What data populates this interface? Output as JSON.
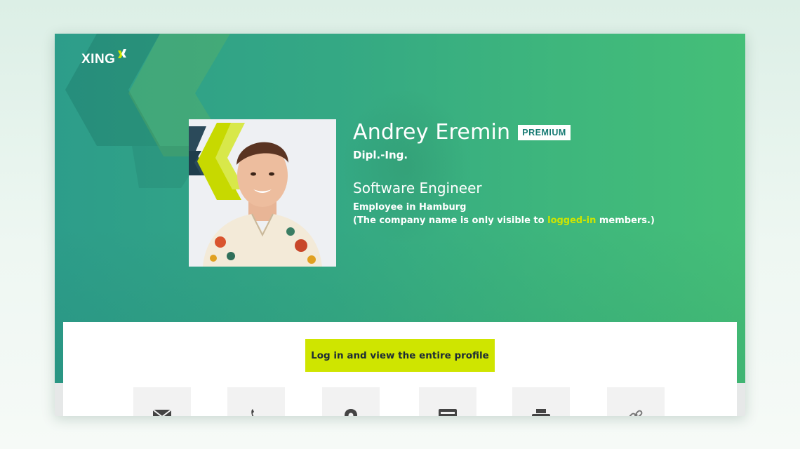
{
  "brand": {
    "logo_text": "XING",
    "accent": "#cfe500",
    "primary": "#2e9e88"
  },
  "profile": {
    "name": "Andrey Eremin",
    "badge": "PREMIUM",
    "degree": "Dipl.-Ing.",
    "job_title": "Software Engineer",
    "employer": "Employee in Hamburg",
    "note_before": "(The company name is only visible to ",
    "note_link": "logged-in",
    "note_after": " members.)"
  },
  "actions": {
    "login_button": "Log in and view the entire profile",
    "icons": [
      "envelope-icon",
      "phone-icon",
      "location-pin-icon",
      "card-icon",
      "printer-icon",
      "link-icon"
    ]
  }
}
